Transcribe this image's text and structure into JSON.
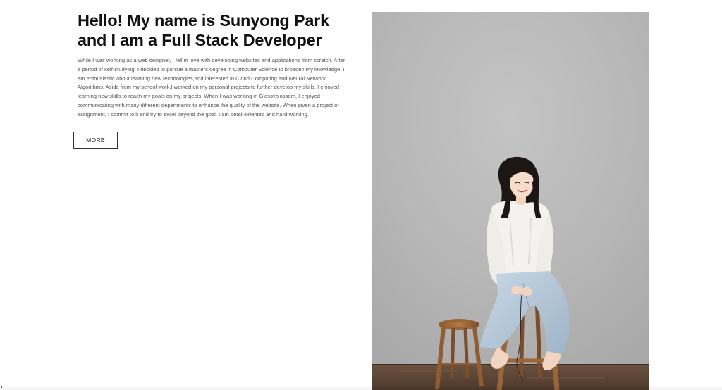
{
  "intro": {
    "headline_line1": "Hello! My name is Sunyong Park",
    "headline_line2": "and I am a Full Stack Developer",
    "bio": "While I was working as a web designer, I fell in love with developing websites and applications from scratch. After a period of self-studying, I decided to pursue a masters degree in Computer Science to broaden my knowledge. I am enthusiastic about learning new technologies,and interested in Cloud Computing and Neural Network Algorithms. Aside from my school work,I worked on my personal projects to further develop my skills. I enjoyed learning new skills to reach my goals on my projects. When I was working in Glossyblossom, I enjoyed communicating with many different departments to enhance the quality of the website. When given a project or assignment, I commit to it and try to excel beyond the goal. I am detail-oriented and hard-working.",
    "more_label": "MORE"
  },
  "colors": {
    "headline": "#111111",
    "body_text": "#555555",
    "photo_wall": "#b9b9b9",
    "photo_floor": "#5c4636",
    "button_border": "#333333"
  }
}
